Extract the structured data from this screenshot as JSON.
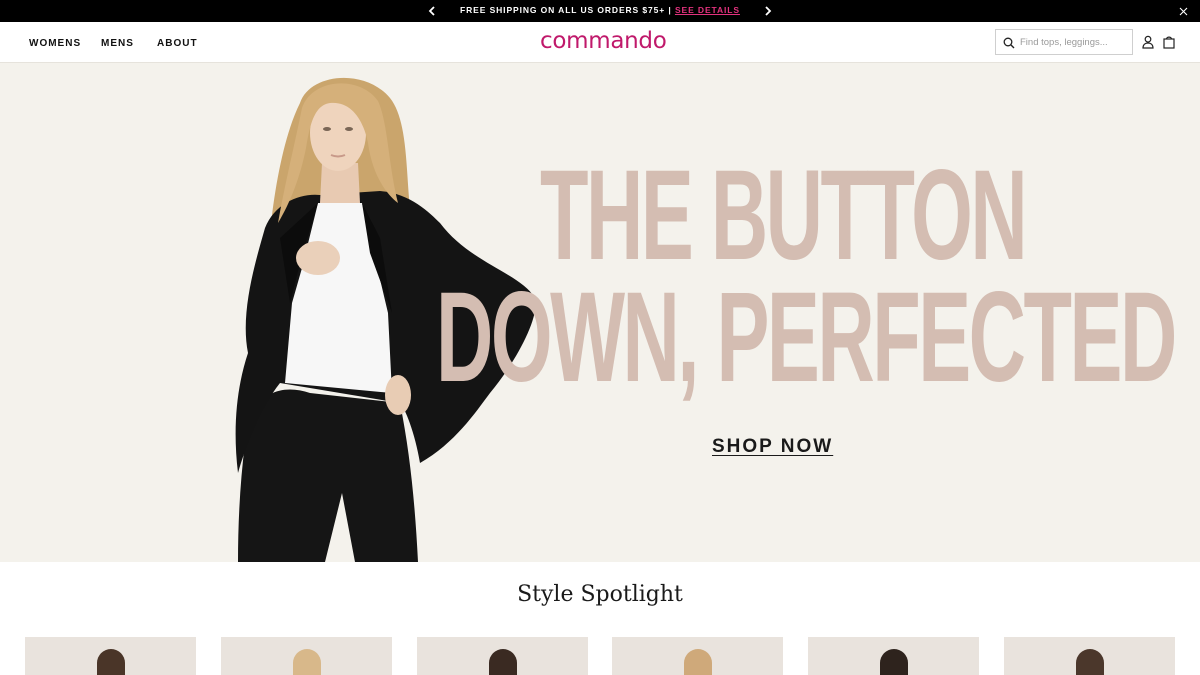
{
  "promo": {
    "text": "FREE SHIPPING ON ALL US ORDERS $75+ |",
    "link": "SEE DETAILS",
    "prev_icon": "chevron-left-icon",
    "next_icon": "chevron-right-icon",
    "close_icon": "close-icon"
  },
  "nav": {
    "items": [
      "WOMENS",
      "MENS",
      "ABOUT"
    ]
  },
  "logo": "commando",
  "search": {
    "placeholder": "Find tops, leggings...",
    "icon": "search-icon"
  },
  "header_icons": [
    "account-icon",
    "cart-icon"
  ],
  "hero": {
    "headline_line1": "THE BUTTON",
    "headline_line2": "DOWN, PERFECTED",
    "cta": "SHOP NOW"
  },
  "spotlight": {
    "title": "Style Spotlight",
    "cards": 6
  },
  "colors": {
    "brand": "#c0196b",
    "promo_link": "#e3327e",
    "headline": "#d4bdb2",
    "hero_bg": "#f4f2ec"
  }
}
